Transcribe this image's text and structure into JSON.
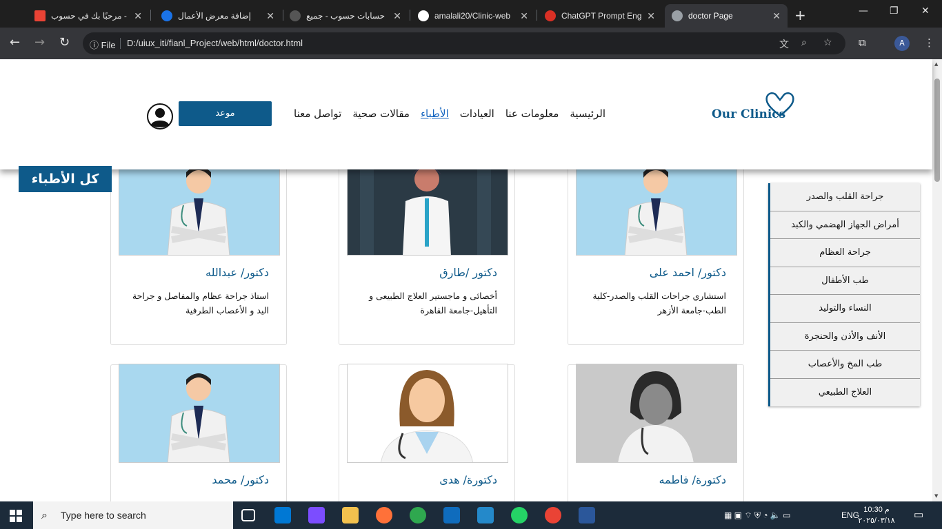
{
  "browser": {
    "tabs": [
      {
        "title": "مرحبًا بك في حسوب -",
        "color": "#ea4335"
      },
      {
        "title": "إضافة معرض الأعمال",
        "color": "#1a73e8"
      },
      {
        "title": "حسابات حسوب - جميع",
        "color": "#555555"
      },
      {
        "title": "amalali20/Clinic-web",
        "color": "#ffffff"
      },
      {
        "title": "ChatGPT Prompt Eng",
        "color": "#d93025"
      },
      {
        "title": "doctor Page",
        "color": "#9aa0a6"
      }
    ],
    "file_label": "File",
    "url": "D:/uiux_iti/fianl_Project/web/html/doctor.html",
    "profile_initial": "A"
  },
  "site": {
    "logo_text": "Our Clinics",
    "nav": [
      "الرئيسية",
      "معلومات عنا",
      "العيادات",
      "الأطباء",
      "مقالات صحية",
      "تواصل معنا"
    ],
    "active_nav": "الأطباء",
    "appointment_label": "موعد",
    "all_doctors_label": "كل الأطباء",
    "specialties": [
      "جراحة القلب والصدر",
      "أمراض الجهاز الهضمي والكبد",
      "جراحة العظام",
      "طب الأطفال",
      "النساء والتوليد",
      "الأنف والأذن والحنجرة",
      "طب المخ والأعصاب",
      "العلاج الطبيعي"
    ],
    "doctors": [
      {
        "name": "دكتور/ احمد على",
        "desc": "استشاري جراحات القلب والصدر-كلية الطب-جامعة الأزهر",
        "photo": "male-doctor-blue"
      },
      {
        "name": "دكتور /طارق",
        "desc": "أخصائى و ماجستير العلاج الطبيعى و التأهيل-جامعة القاهرة",
        "photo": "female-doctor-dark"
      },
      {
        "name": "دكتور/ عبدالله",
        "desc": "استاذ جراحة عظام والمفاصل و جراحة اليد و الأعصاب الطرفية",
        "photo": "male-doctor-blue"
      },
      {
        "name": "دكتورة/ فاطمه",
        "desc": "",
        "photo": "female-doctor-gray"
      },
      {
        "name": "دكتورة/ هدى",
        "desc": "",
        "photo": "female-doctor-light"
      },
      {
        "name": "دكتور/ محمد",
        "desc": "",
        "photo": "male-doctor-blue"
      }
    ]
  },
  "taskbar": {
    "search_placeholder": "Type here to search",
    "lang": "ENG",
    "time": "10:30 م",
    "date": "٢٠٢٥/٠٣/١٨"
  }
}
